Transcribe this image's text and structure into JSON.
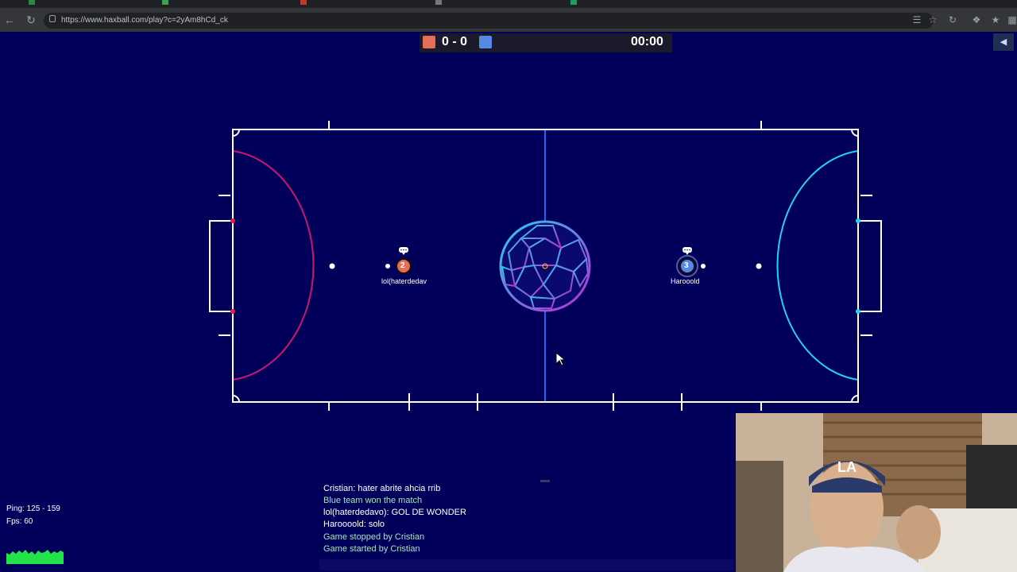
{
  "browser": {
    "url": "https://www.haxball.com/play?c=2yAm8hCd_ck"
  },
  "game": {
    "score": "0 - 0",
    "timer": "00:00",
    "colors": {
      "red": "#e56e56",
      "blue": "#5689e5",
      "background": "#00005a",
      "left_area": "#c8176e",
      "right_area": "#22d3ee"
    },
    "players": [
      {
        "number": "2",
        "name": "lol(haterdedav",
        "team": "red"
      },
      {
        "number": "3",
        "name": "Harooold",
        "team": "blue"
      }
    ]
  },
  "chat": {
    "messages": [
      {
        "text": "Cristian: hater abrite ahcia rrib",
        "kind": "player"
      },
      {
        "text": "Blue team won the match",
        "kind": "system"
      },
      {
        "text": "lol(haterdedavo): GOL DE WONDER",
        "kind": "player"
      },
      {
        "text": "Haroooold: solo",
        "kind": "player"
      },
      {
        "text": "Game stopped by Cristian",
        "kind": "system"
      },
      {
        "text": "Game started by Cristian",
        "kind": "system"
      }
    ]
  },
  "stats": {
    "ping": "Ping: 125 - 159",
    "fps": "Fps: 60"
  }
}
